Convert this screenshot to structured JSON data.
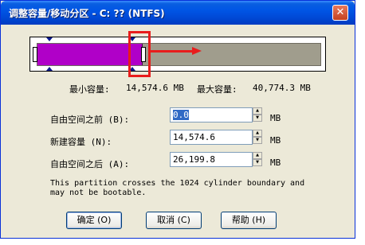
{
  "window": {
    "title": "调整容量/移动分区 - C: ?? (NTFS)",
    "close_glyph": "✕"
  },
  "partition_bar": {
    "used_fraction": 0.37,
    "fill_color": "#b000c8",
    "free_color": "#a09d8d",
    "highlight_color": "#e81c1c"
  },
  "size_info": {
    "min_label": "最小容量:",
    "min_value": "14,574.6 MB",
    "max_label": "最大容量:",
    "max_value": "40,774.3 MB"
  },
  "fields": [
    {
      "label": "自由空间之前 (B):",
      "value": "0.0",
      "unit": "MB"
    },
    {
      "label": "新建容量 (N):",
      "value": "14,574.6",
      "unit": "MB"
    },
    {
      "label": "自由空间之后 (A):",
      "value": "26,199.8",
      "unit": "MB"
    }
  ],
  "note": "This partition crosses the 1024 cylinder boundary and may not be bootable.",
  "buttons": {
    "ok": "确定 (O)",
    "cancel": "取消 (C)",
    "help": "帮助 (H)"
  }
}
